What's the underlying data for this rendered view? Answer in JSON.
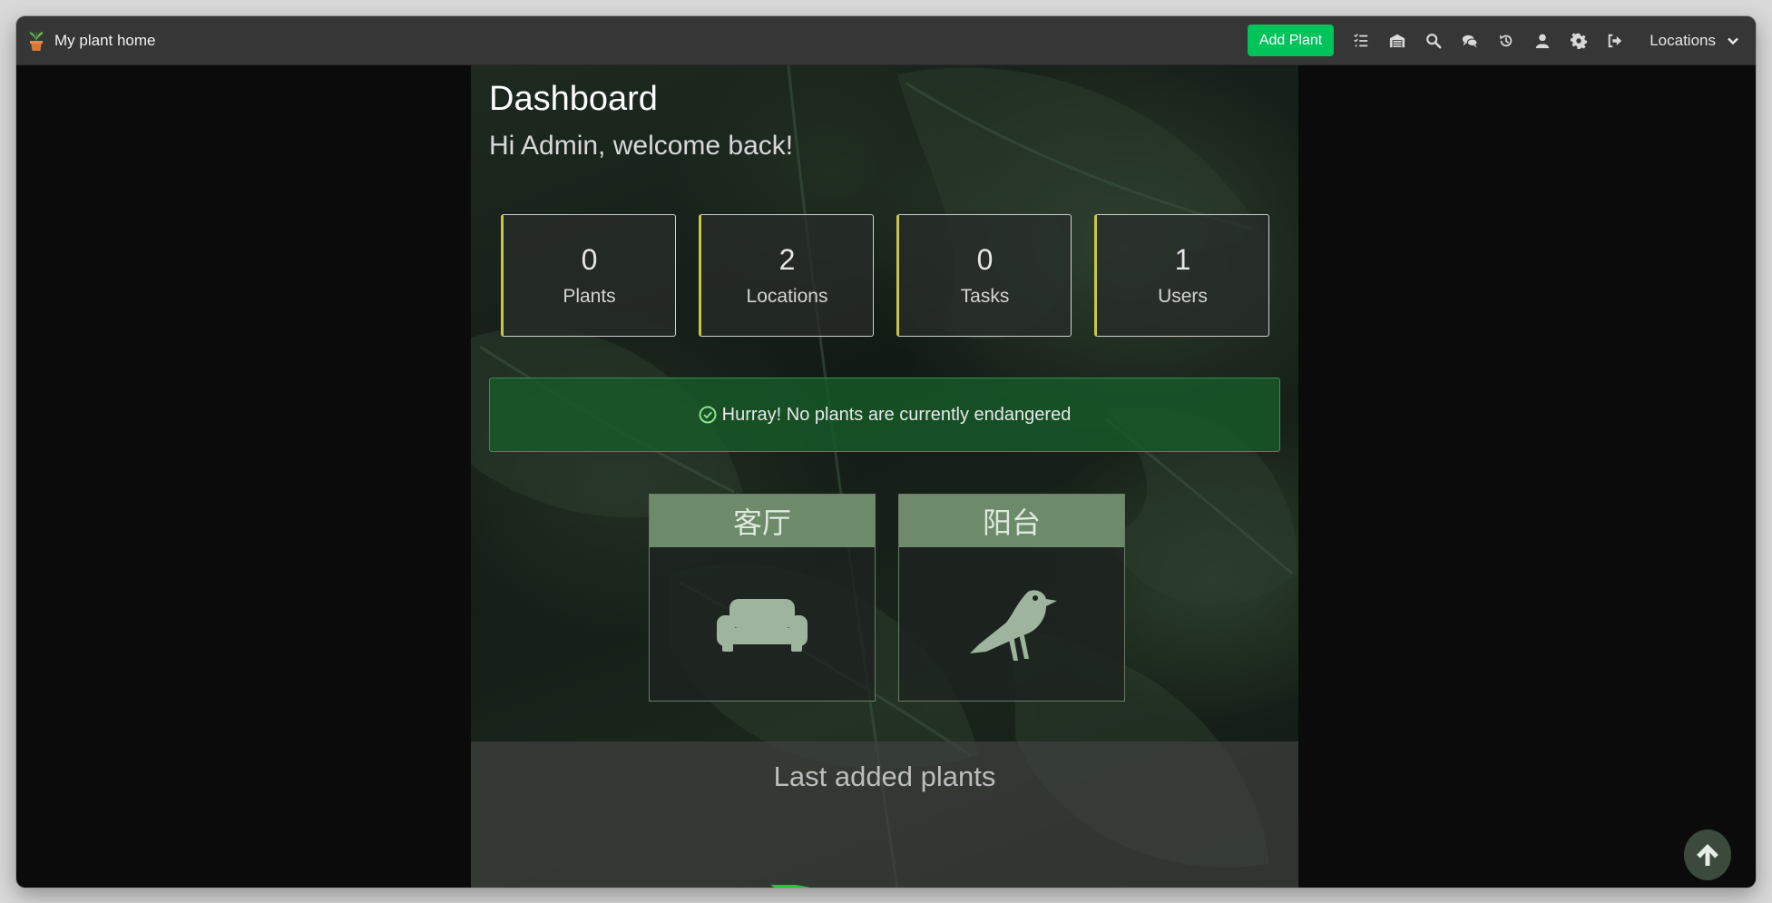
{
  "navbar": {
    "brand": "My plant home",
    "add_plant": "Add Plant",
    "icons": [
      "tasks-icon",
      "warehouse-icon",
      "search-icon",
      "chat-icon",
      "history-icon",
      "user-icon",
      "gear-icon",
      "logout-icon"
    ],
    "locations_menu": "Locations"
  },
  "dashboard": {
    "title": "Dashboard",
    "welcome": "Hi Admin, welcome back!"
  },
  "stats": [
    {
      "value": "0",
      "label": "Plants"
    },
    {
      "value": "2",
      "label": "Locations"
    },
    {
      "value": "0",
      "label": "Tasks"
    },
    {
      "value": "1",
      "label": "Users"
    }
  ],
  "alert": {
    "text": "Hurray! No plants are currently endangered",
    "icon": "check-circle-icon"
  },
  "locations": [
    {
      "name": "客厅",
      "icon": "couch-icon"
    },
    {
      "name": "阳台",
      "icon": "crow-icon"
    }
  ],
  "last_added": {
    "title": "Last added plants"
  },
  "colors": {
    "accent": "#00c35a",
    "navbar": "#363636",
    "stat_border": "#c7c64a",
    "alert_bg": "#175a28",
    "location_header": "#6d8a6a"
  }
}
